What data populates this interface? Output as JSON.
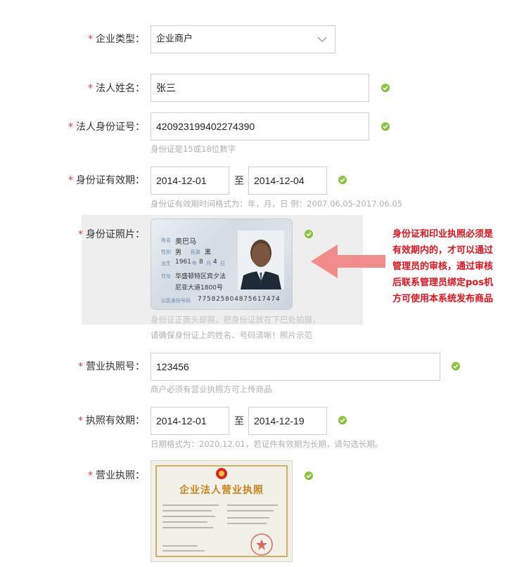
{
  "colors": {
    "required": "#e4393c",
    "check": "#8cc63e",
    "note": "#e5121b",
    "arrow": "#f28b8b",
    "hint": "#b0b0b0"
  },
  "form": {
    "company_type": {
      "label": "企业类型：",
      "value": "企业商户"
    },
    "legal_name": {
      "label": "法人姓名：",
      "value": "张三"
    },
    "legal_id": {
      "label": "法人身份证号：",
      "value": "420923199402274390",
      "hint": "身份证是15或18位数字"
    },
    "id_validity": {
      "label": "身份证有效期：",
      "start": "2014-12-01",
      "to": "至",
      "end": "2014-12-04",
      "hint": "身份证有效期时间格式为：年，月，日 例：2007.06.05-2017.06.05"
    },
    "id_photo": {
      "label": "身份证照片：",
      "hint1": "身份证正面头部照，把身份证放在下巴处拍摄，",
      "hint2": "请确保身份证上的姓名、号码清晰！照片示范",
      "card": {
        "name_key": "姓名",
        "name": "奥巴马",
        "sex_key": "性别",
        "sex": "男",
        "nation_key": "民族",
        "nation": "黑",
        "birth_key": "出生",
        "year": "1961",
        "year_unit": "年",
        "month": "8",
        "month_unit": "月",
        "day": "4",
        "day_unit": "日",
        "addr_key": "住址",
        "addr1": "华盛顿特区宾夕法",
        "addr2": "尼亚大道1800号",
        "id_key": "公民身份号码",
        "id": "775825804875617474"
      }
    },
    "license_no": {
      "label": "营业执照号：",
      "value": "123456",
      "hint": "商户必须有营业执照方可上传商品"
    },
    "license_validity": {
      "label": "执照有效期：",
      "start": "2014-12-01",
      "to": "至",
      "end": "2014-12-19",
      "hint": "日期格式为：2020.12.01，若证件有效期为长期，请勾选长期。"
    },
    "license": {
      "label": "营业执照：",
      "title": "企业法人营业执照"
    }
  },
  "note": "身份证和印业执照必须是有效期内的，才可以通过管理员的审核，通过审核后联系管理员绑定pos机方可使用本系统发布商品"
}
